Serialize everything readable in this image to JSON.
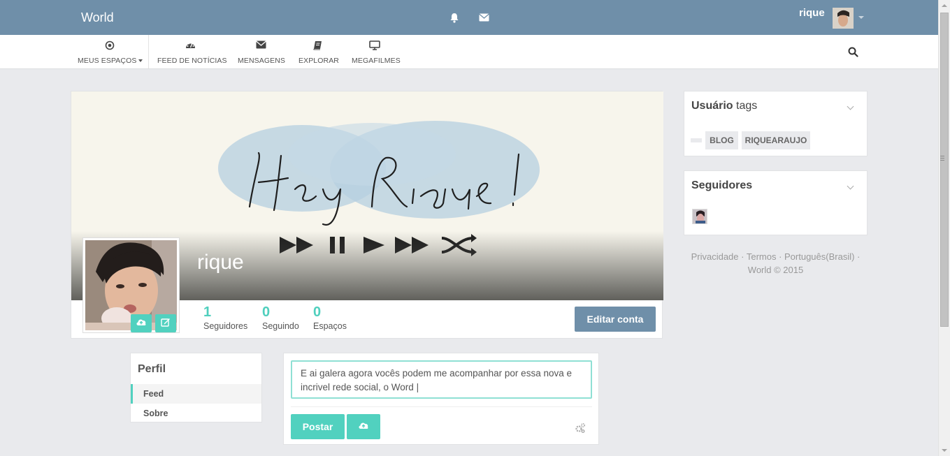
{
  "topbar": {
    "brand": "World",
    "username": "rique"
  },
  "nav": {
    "items": [
      {
        "label": "MEUS ESPAÇOS",
        "icon": "target-icon"
      },
      {
        "label": "FEED DE NOTÍCIAS",
        "icon": "dashboard-icon"
      },
      {
        "label": "MENSAGENS",
        "icon": "envelope-icon"
      },
      {
        "label": "EXPLORAR",
        "icon": "book-icon"
      },
      {
        "label": "MEGAFILMES",
        "icon": "monitor-icon"
      }
    ]
  },
  "profile": {
    "cover_text": "Hey Rique!",
    "name": "rique",
    "stats": [
      {
        "value": "1",
        "label": "Seguidores"
      },
      {
        "value": "0",
        "label": "Seguindo"
      },
      {
        "value": "0",
        "label": "Espaços"
      }
    ],
    "edit_label": "Editar conta"
  },
  "tags_card": {
    "title_bold": "Usuário",
    "title_rest": " tags",
    "tags": [
      "BLOG",
      "RIQUEARAUJO"
    ]
  },
  "followers_card": {
    "title": "Seguidores"
  },
  "footer": {
    "line1": "Privacidade · Termos · Português(Brasil) ·",
    "line2": "World © 2015"
  },
  "perfil_menu": {
    "title": "Perfil",
    "items": [
      "Feed",
      "Sobre"
    ]
  },
  "composer": {
    "text": "E ai galera agora vocês podem me acompanhar por essa nova e incrivel rede social, o Word |",
    "post_label": "Postar"
  },
  "colors": {
    "topbar": "#6f8fa9",
    "accent": "#51d1bf",
    "background": "#e9eaed"
  }
}
